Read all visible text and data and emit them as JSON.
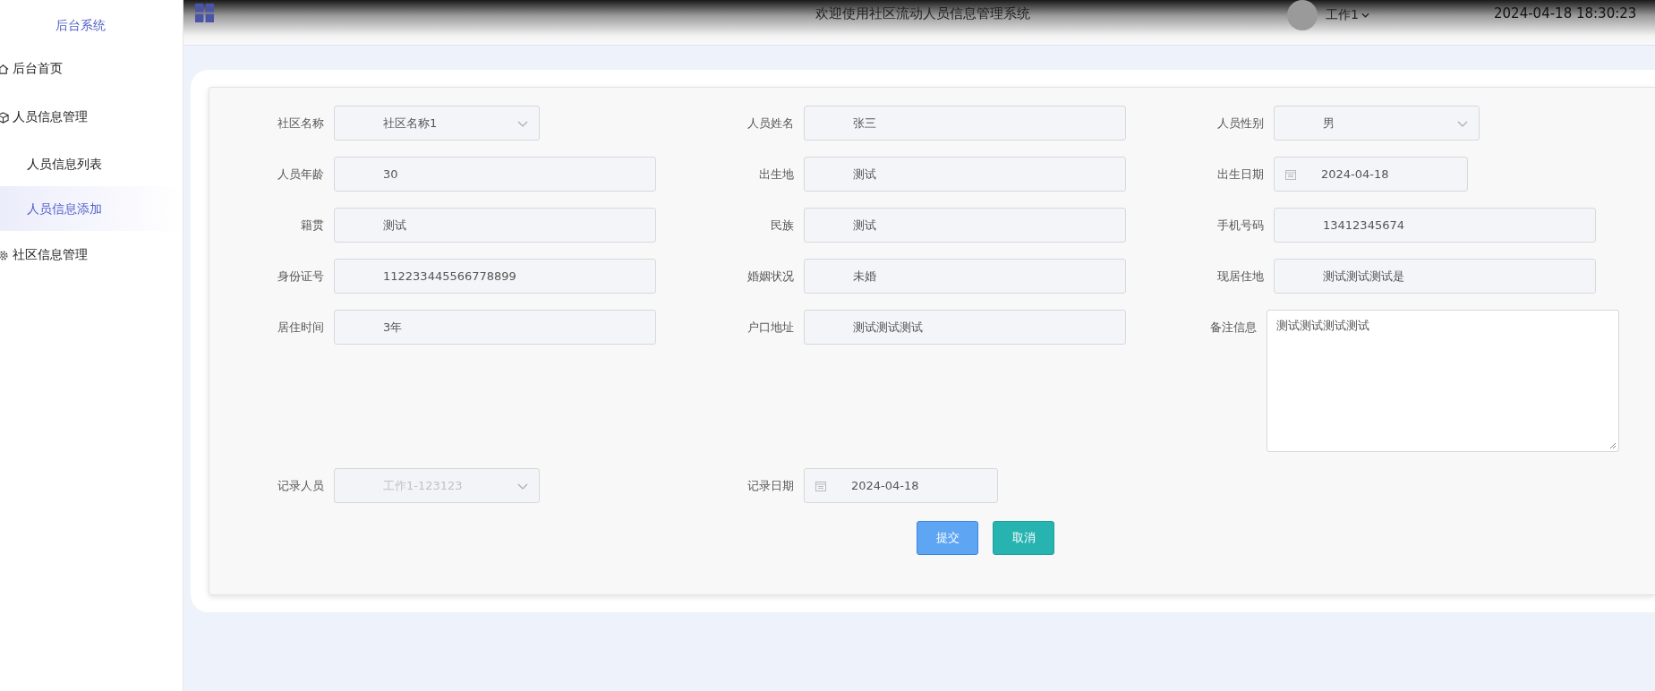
{
  "sidebar": {
    "title": "后台系统",
    "items": [
      {
        "label": "后台首页",
        "kind": "home",
        "selected": false
      },
      {
        "label": "人员信息管理",
        "kind": "group",
        "selected": false,
        "children": [
          {
            "label": "人员信息列表",
            "selected": false
          },
          {
            "label": "人员信息添加",
            "selected": true
          }
        ]
      },
      {
        "label": "社区信息管理",
        "kind": "settings",
        "selected": false
      }
    ]
  },
  "header": {
    "title": "欢迎使用社区流动人员信息管理系统",
    "user": "工作1",
    "datetime": "2024-04-18 18:30:23"
  },
  "form": {
    "fields": [
      {
        "label": "社区名称",
        "kind": "select",
        "value": "社区名称1",
        "disabled": false
      },
      {
        "label": "人员姓名",
        "kind": "text",
        "value": "张三",
        "disabled": false
      },
      {
        "label": "人员性别",
        "kind": "select",
        "value": "男",
        "disabled": false
      },
      {
        "label": "人员年龄",
        "kind": "text",
        "value": "30",
        "disabled": false
      },
      {
        "label": "出生地",
        "kind": "text",
        "value": "测试",
        "disabled": false
      },
      {
        "label": "出生日期",
        "kind": "date",
        "value": "2024-04-18",
        "disabled": false
      },
      {
        "label": "籍贯",
        "kind": "text",
        "value": "测试",
        "disabled": false
      },
      {
        "label": "民族",
        "kind": "text",
        "value": "测试",
        "disabled": false
      },
      {
        "label": "手机号码",
        "kind": "text",
        "value": "13412345674",
        "disabled": false
      },
      {
        "label": "身份证号",
        "kind": "text",
        "value": "112233445566778899",
        "disabled": false
      },
      {
        "label": "婚姻状况",
        "kind": "text",
        "value": "未婚",
        "disabled": false
      },
      {
        "label": "现居住地",
        "kind": "text",
        "value": "测试测试测试是",
        "disabled": false
      },
      {
        "label": "居住时间",
        "kind": "text",
        "value": "3年",
        "disabled": false
      },
      {
        "label": "户口地址",
        "kind": "text",
        "value": "测试测试测试",
        "disabled": false
      },
      {
        "label": "备注信息",
        "kind": "textarea",
        "value": "测试测试测试测试",
        "disabled": false
      },
      {
        "label": "记录人员",
        "kind": "select",
        "value": "工作1-123123",
        "disabled": true
      },
      {
        "label": "记录日期",
        "kind": "date",
        "value": "2024-04-18",
        "disabled": false
      }
    ],
    "buttons": [
      {
        "label": "提交",
        "kind": "primary"
      },
      {
        "label": "取消",
        "kind": "cancel"
      }
    ]
  }
}
